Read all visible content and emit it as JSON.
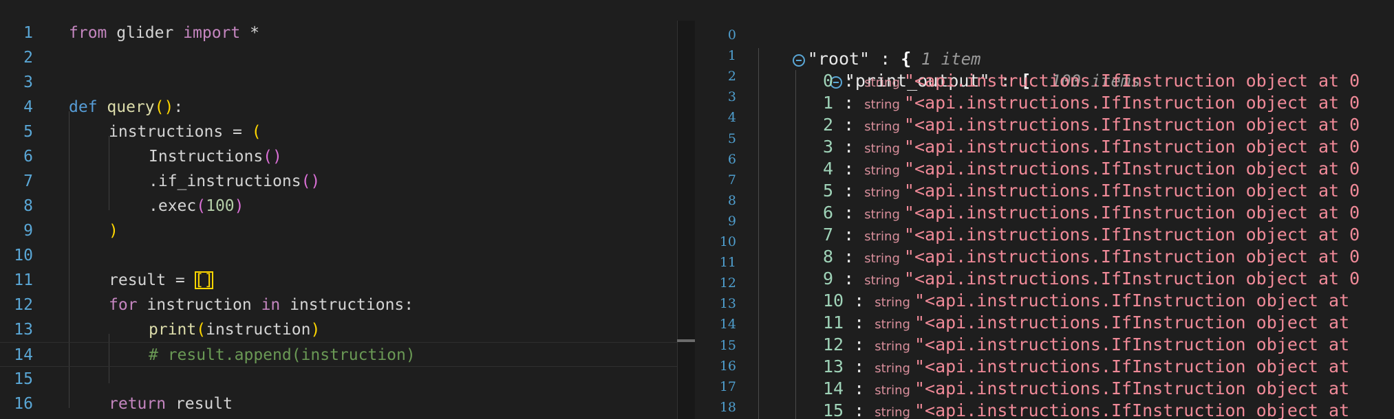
{
  "editor": {
    "lines": [
      {
        "n": "1",
        "tokens": [
          [
            "kw-ctrl",
            "from"
          ],
          [
            "var",
            " glider "
          ],
          [
            "kw-ctrl",
            "import"
          ],
          [
            "var",
            " *"
          ]
        ],
        "indent": 0
      },
      {
        "n": "2",
        "tokens": [],
        "indent": 0
      },
      {
        "n": "3",
        "tokens": [],
        "indent": 0
      },
      {
        "n": "4",
        "tokens": [
          [
            "kw-def",
            "def"
          ],
          [
            "var",
            " "
          ],
          [
            "fn",
            "query"
          ],
          [
            "br1",
            "()"
          ],
          [
            "var",
            ":"
          ]
        ],
        "indent": 0
      },
      {
        "n": "5",
        "tokens": [
          [
            "var",
            "instructions = "
          ],
          [
            "br1",
            "("
          ]
        ],
        "indent": 1
      },
      {
        "n": "6",
        "tokens": [
          [
            "var",
            "Instructions"
          ],
          [
            "br2",
            "()"
          ]
        ],
        "indent": 2
      },
      {
        "n": "7",
        "tokens": [
          [
            "var",
            ".if_instructions"
          ],
          [
            "br2",
            "()"
          ]
        ],
        "indent": 2
      },
      {
        "n": "8",
        "tokens": [
          [
            "var",
            ".exec"
          ],
          [
            "br2",
            "("
          ],
          [
            "num",
            "100"
          ],
          [
            "br2",
            ")"
          ]
        ],
        "indent": 2
      },
      {
        "n": "9",
        "tokens": [
          [
            "br1",
            ")"
          ]
        ],
        "indent": 1
      },
      {
        "n": "10",
        "tokens": [],
        "indent": 0
      },
      {
        "n": "11",
        "tokens": [
          [
            "var",
            "result = "
          ],
          [
            "br1 br-hl",
            "[]"
          ]
        ],
        "indent": 1
      },
      {
        "n": "12",
        "tokens": [
          [
            "kw-ctrl",
            "for"
          ],
          [
            "var",
            " instruction "
          ],
          [
            "kw-ctrl",
            "in"
          ],
          [
            "var",
            " instructions:"
          ]
        ],
        "indent": 1
      },
      {
        "n": "13",
        "tokens": [
          [
            "fn",
            "print"
          ],
          [
            "br1",
            "("
          ],
          [
            "var",
            "instruction"
          ],
          [
            "br1",
            ")"
          ]
        ],
        "indent": 2
      },
      {
        "n": "14",
        "tokens": [
          [
            "cmt",
            "# result.append(instruction)"
          ]
        ],
        "indent": 2
      },
      {
        "n": "15",
        "tokens": [],
        "indent": 0
      },
      {
        "n": "16",
        "tokens": [
          [
            "kw-ctrl",
            "return"
          ],
          [
            "var",
            " result"
          ]
        ],
        "indent": 1
      }
    ]
  },
  "json_viewer": {
    "line_numbers": [
      "0",
      "1",
      "2",
      "3",
      "4",
      "5",
      "6",
      "7",
      "8",
      "9",
      "10",
      "11",
      "12",
      "13",
      "14",
      "15",
      "16",
      "17",
      "18"
    ],
    "root_key": "\"root\"",
    "root_brace": "{",
    "root_meta": "1 item",
    "child_key": "\"print_output\"",
    "child_brace": "[",
    "child_meta": "100 items",
    "type_label": "string",
    "items": [
      {
        "idx": "0",
        "value": "\"<api.instructions.IfInstruction object at 0"
      },
      {
        "idx": "1",
        "value": "\"<api.instructions.IfInstruction object at 0"
      },
      {
        "idx": "2",
        "value": "\"<api.instructions.IfInstruction object at 0"
      },
      {
        "idx": "3",
        "value": "\"<api.instructions.IfInstruction object at 0"
      },
      {
        "idx": "4",
        "value": "\"<api.instructions.IfInstruction object at 0"
      },
      {
        "idx": "5",
        "value": "\"<api.instructions.IfInstruction object at 0"
      },
      {
        "idx": "6",
        "value": "\"<api.instructions.IfInstruction object at 0"
      },
      {
        "idx": "7",
        "value": "\"<api.instructions.IfInstruction object at 0"
      },
      {
        "idx": "8",
        "value": "\"<api.instructions.IfInstruction object at 0"
      },
      {
        "idx": "9",
        "value": "\"<api.instructions.IfInstruction object at 0"
      },
      {
        "idx": "10",
        "value": "\"<api.instructions.IfInstruction object at"
      },
      {
        "idx": "11",
        "value": "\"<api.instructions.IfInstruction object at"
      },
      {
        "idx": "12",
        "value": "\"<api.instructions.IfInstruction object at"
      },
      {
        "idx": "13",
        "value": "\"<api.instructions.IfInstruction object at"
      },
      {
        "idx": "14",
        "value": "\"<api.instructions.IfInstruction object at"
      },
      {
        "idx": "15",
        "value": "\"<api.instructions.IfInstruction object at"
      }
    ]
  }
}
